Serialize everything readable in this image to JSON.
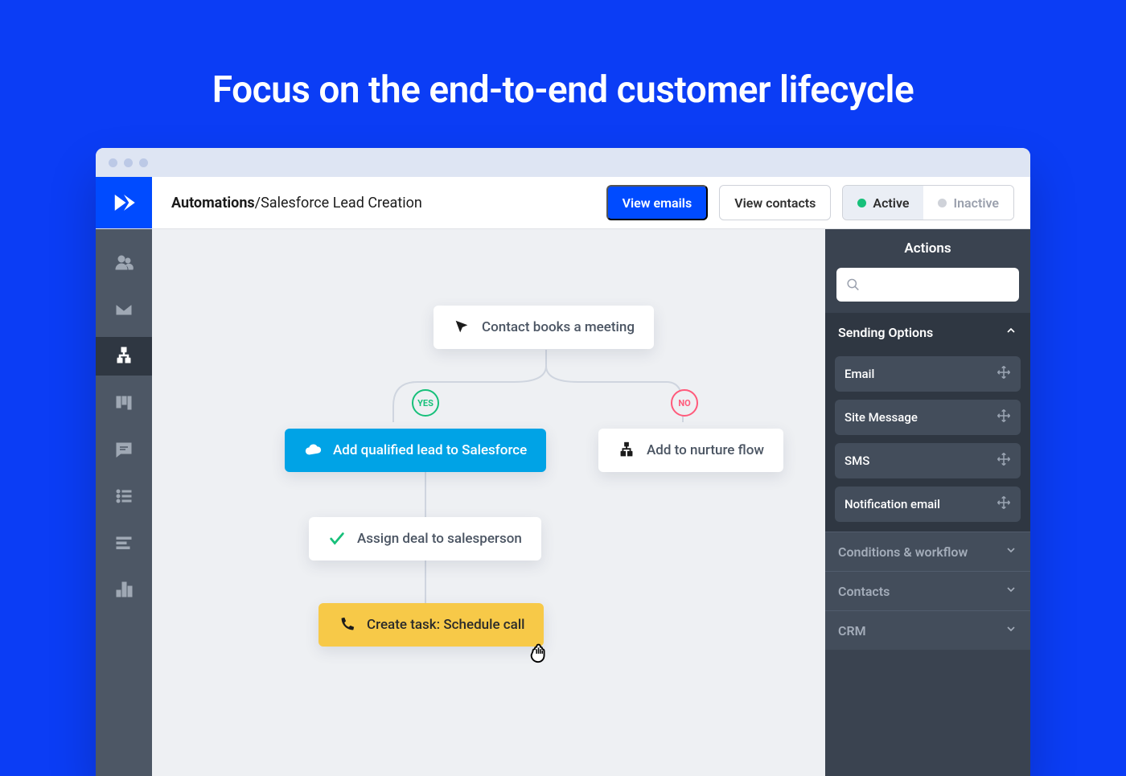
{
  "hero_title": "Focus on the end-to-end customer lifecycle",
  "breadcrumb": {
    "root": "Automations",
    "sep": " / ",
    "page": "Salesforce Lead Creation"
  },
  "topbar": {
    "view_emails": "View emails",
    "view_contacts": "View contacts",
    "active": "Active",
    "inactive": "Inactive"
  },
  "sidenav": {
    "items": [
      {
        "name": "contacts",
        "icon": "people-icon"
      },
      {
        "name": "campaigns",
        "icon": "envelope-icon"
      },
      {
        "name": "automations",
        "icon": "automation-icon",
        "active": true
      },
      {
        "name": "deals",
        "icon": "kanban-icon"
      },
      {
        "name": "conversations",
        "icon": "message-icon"
      },
      {
        "name": "lists",
        "icon": "list-icon"
      },
      {
        "name": "forms",
        "icon": "text-align-icon"
      },
      {
        "name": "reports",
        "icon": "bar-chart-icon"
      }
    ]
  },
  "flow": {
    "trigger": "Contact books a meeting",
    "yes_branch": "YES",
    "no_branch": "NO",
    "node_salesforce": "Add qualified lead to Salesforce",
    "node_nurture": "Add to nurture flow",
    "node_assign": "Assign deal to salesperson",
    "node_task": "Create task: Schedule call"
  },
  "actions": {
    "title": "Actions",
    "search_placeholder": "",
    "sections": {
      "sending": {
        "label": "Sending Options",
        "open": true,
        "items": [
          "Email",
          "Site Message",
          "SMS",
          "Notification email"
        ]
      },
      "conditions": {
        "label": "Conditions & workflow"
      },
      "contacts": {
        "label": "Contacts"
      },
      "crm": {
        "label": "CRM"
      }
    }
  }
}
